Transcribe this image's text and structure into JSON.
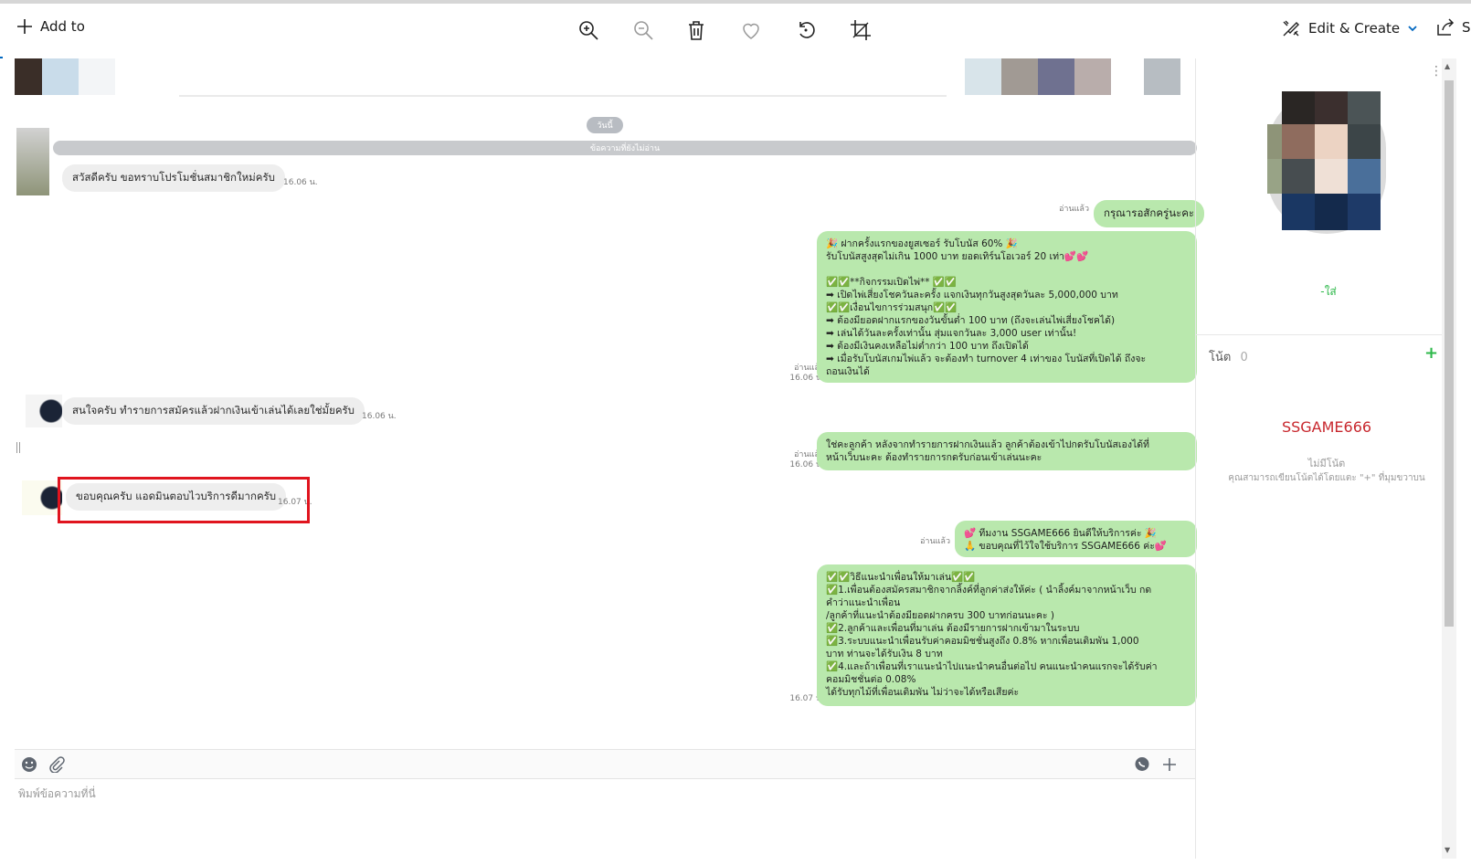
{
  "toolbar": {
    "add_to_label": "Add to",
    "edit_create_label": "Edit & Create",
    "share_label": "S",
    "icons": [
      "zoom-in-icon",
      "zoom-out-icon",
      "delete-icon",
      "heart-icon",
      "rotate-icon",
      "crop-icon"
    ]
  },
  "chat": {
    "date_pill": "วันนี้",
    "unread_label": "ข้อความที่ยังไม่อ่าน",
    "messages": [
      {
        "side": "in",
        "text": "สวัสดีครับ ขอทราบโปรโมชั่นสมาชิกใหม่ครับ",
        "time": "16.06 น."
      },
      {
        "side": "out",
        "text": "กรุณารอสักครู่นะคะ",
        "read": "อ่านแล้ว"
      },
      {
        "side": "out",
        "read": "อ่านแล้ว",
        "time": "16.06 น.",
        "text": "🎉 ฝากครั้งแรกของยูสเซอร์ รับโบนัส 60% 🎉\nรับโบนัสสูงสุดไม่เกิน 1000 บาท ยอดเทิร์นโอเวอร์ 20 เท่า💕💕\n\n✅✅**กิจกรรมเปิดไพ่** ✅✅\n➡ เปิดไพ่เสี่ยงโชควันละครั้ง แจกเงินทุกวันสูงสุดวันละ 5,000,000 บาท\n✅✅เงื่อนไขการร่วมสนุก✅✅\n➡ ต้องมียอดฝากแรกของวันขั้นต่ำ 100 บาท (ถึงจะเล่นไพ่เสี่ยงโชคได้)\n➡ เล่นได้วันละครั้งเท่านั้น สุ่มแจกวันละ 3,000 user เท่านั้น!\n➡ ต้องมีเงินคงเหลือไม่ต่ำกว่า 100 บาท ถึงเปิดได้\n➡ เมื่อรับโบนัสเกมไพ่แล้ว จะต้องทำ turnover 4 เท่าของ โบนัสที่เปิดได้ ถึงจะ\nถอนเงินได้"
      },
      {
        "side": "in",
        "text": "สนใจครับ ทำรายการสมัครแล้วฝากเงินเข้าเล่นได้เลยใช่มั้ยครับ",
        "time": "16.06 น."
      },
      {
        "side": "out",
        "read": "อ่านแล้ว",
        "time": "16.06 น.",
        "text": "ใช่คะลูกค้า หลังจากทำรายการฝากเงินแล้ว ลูกค้าต้องเข้าไปกดรับโบนัสเองได้ที่\nหน้าเว็บนะคะ ต้องทำรายการกดรับก่อนเข้าเล่นนะคะ"
      },
      {
        "side": "in",
        "text": "ขอบคุณครับ แอดมินตอบไวบริการดีมากครับ",
        "time": "16.07 น."
      },
      {
        "side": "out",
        "read": "อ่านแล้ว",
        "text": "💕 ทีมงาน SSGAME666 ยินดีให้บริการค่ะ 🎉\n🙏 ขอบคุณที่ไว้ใจใช้บริการ SSGAME666 ค่ะ💕"
      },
      {
        "side": "out",
        "time": "16.07 น.",
        "text": "✅✅วิธีแนะนำเพื่อนให้มาเล่น✅✅\n✅1.เพื่อนต้องสมัครสมาชิกจากลิ้งค์ที่ลูกค่าส่งให้ค่ะ ( นำลิ้งค์มาจากหน้าเว็บ กด\nคำว่าแนะนำเพื่อน\n/ลูกค้าที่แนะนำต้องมียอดฝากครบ 300 บาทก่อนนะคะ )\n✅2.ลูกค้าและเพื่อนที่มาเล่น ต้องมีรายการฝากเข้ามาในระบบ\n✅3.ระบบแนะนำเพื่อนรับค่าคอมมิชชั่นสูงถึง 0.8% หากเพื่อนเติมพัน 1,000\nบาท ท่านจะได้รับเงิน 8 บาท\n✅4.และถ้าเพื่อนที่เราแนะนำไปแนะนำคนอื่นต่อไป คนแนะนำคนแรกจะได้รับค่า\nคอมมิชชั่นต่อ 0.08%\nได้รับทุกไม้ที่เพื่อนเติมพัน ไม่ว่าจะได้หรือเสียค่ะ"
      }
    ],
    "input_placeholder": "พิมพ์ข้อความที่นี่"
  },
  "side": {
    "name_fragment": "-ใส่",
    "note_label": "โน้ต",
    "note_count": "0",
    "account_name": "SSGAME666",
    "no_note": "ไม่มีโน้ต",
    "note_hint": "คุณสามารถเขียนโน้ตได้โดยแตะ \"+\" ที่มุมขวาบน"
  },
  "colors": {
    "accent": "#0067c0",
    "bubble_out": "#b9e8ad",
    "bubble_in": "#eeeeee",
    "highlight": "#e0141e",
    "account_red": "#c8282e",
    "add_green": "#2eb84a"
  }
}
